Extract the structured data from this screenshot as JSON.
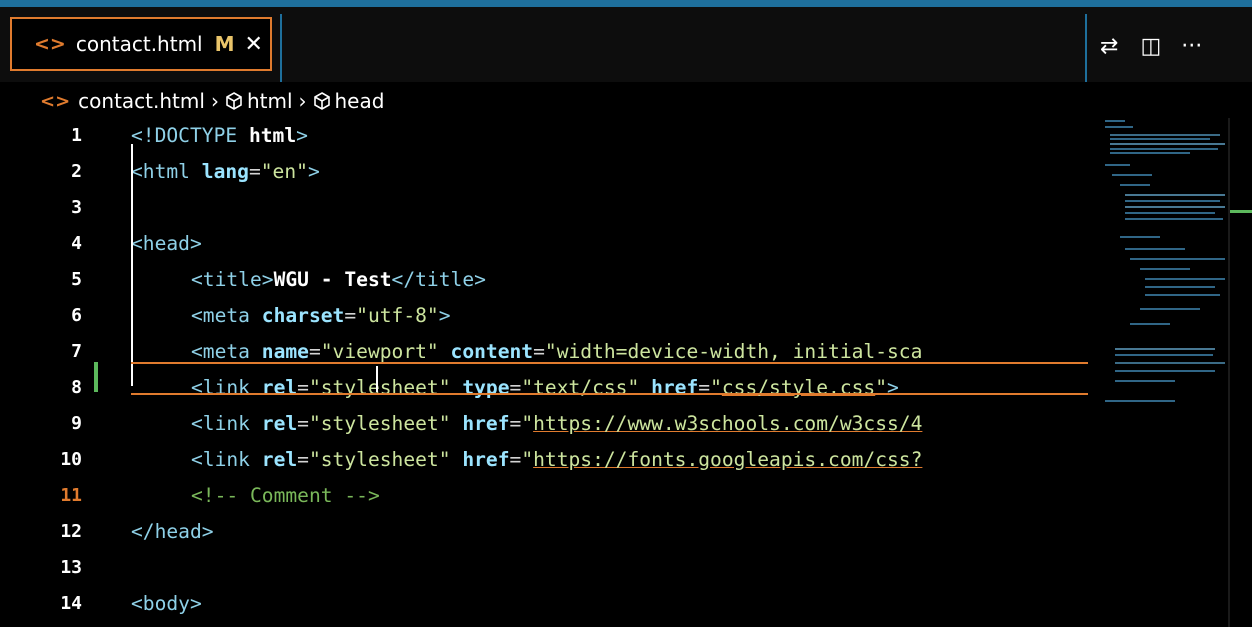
{
  "tab": {
    "icon": "html-file-icon",
    "filename": "contact.html",
    "modified_badge": "M",
    "close_glyph": "✕"
  },
  "actions": {
    "compare": "⇄",
    "split": "◫",
    "more": "···"
  },
  "breadcrumb": {
    "file": "contact.html",
    "sep": "›",
    "items": [
      "html",
      "head"
    ]
  },
  "editor": {
    "line_numbers": [
      "1",
      "2",
      "3",
      "4",
      "5",
      "6",
      "7",
      "8",
      "9",
      "10",
      "11",
      "12",
      "13",
      "14"
    ],
    "current_line": "11",
    "lines": [
      "1",
      "2",
      "3",
      "4",
      "5",
      "6",
      "7",
      "8",
      "9",
      "10",
      "11",
      "12",
      "13",
      "14"
    ],
    "l1": {
      "a": "<!DOCTYPE ",
      "b": "html",
      ">": ">"
    },
    "l2": {
      "a": "<html ",
      "b": "lang",
      "c": "=",
      "d": "\"en\"",
      "e": ">"
    },
    "l4": {
      "a": "<head>"
    },
    "l5": {
      "a": "<title>",
      "b": "WGU - Test",
      "c": "</title>"
    },
    "l6": {
      "a": "<meta ",
      "b": "charset",
      "c": "=",
      "d": "\"utf-8\"",
      "e": ">"
    },
    "l7": {
      "a": "<meta ",
      "b": "name",
      "c": "=",
      "d": "\"viewport\"",
      "e": " ",
      "f": "content",
      "g": "=",
      "h": "\"width=device-width, initial-sca"
    },
    "l8": {
      "a": "<link ",
      "b": "rel",
      "c": "=",
      "d": "\"stylesheet\"",
      "e": " ",
      "f": "type",
      "g": "=",
      "h": "\"text/css\"",
      "i": " ",
      "j": "href",
      "k": "=",
      "l": "\"",
      "m": "css/style.css",
      "n": "\"",
      "o": ">"
    },
    "l9": {
      "a": "<link ",
      "b": "rel",
      "c": "=",
      "d": "\"stylesheet\"",
      "e": " ",
      "f": "href",
      "g": "=",
      "h": "\"",
      "i": "https://www.w3schools.com/w3css/4"
    },
    "l10": {
      "a": "<link ",
      "b": "rel",
      "c": "=",
      "d": "\"stylesheet\"",
      "e": " ",
      "f": "href",
      "g": "=",
      "h": "\"",
      "i": "https://fonts.googleapis.com/css?"
    },
    "l11": {
      "a": "<!-- Comment ",
      "b": "-->"
    },
    "l12": {
      "a": "</head>"
    },
    "l14": {
      "a": "<body>"
    }
  },
  "colors": {
    "accent": "#e07b2e",
    "tag": "#8fd1e8",
    "string": "#cde59f",
    "comment": "#7ab85a",
    "git_added": "#5cb85c"
  }
}
